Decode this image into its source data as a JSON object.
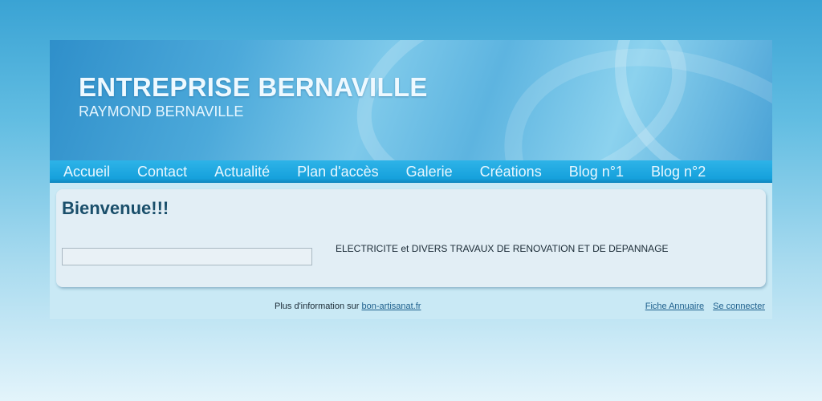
{
  "header": {
    "title": "ENTREPRISE BERNAVILLE",
    "subtitle": "RAYMOND BERNAVILLE"
  },
  "nav": {
    "items": [
      {
        "label": "Accueil"
      },
      {
        "label": "Contact"
      },
      {
        "label": "Actualité"
      },
      {
        "label": "Plan d'accès"
      },
      {
        "label": "Galerie"
      },
      {
        "label": "Créations"
      },
      {
        "label": "Blog n°1"
      },
      {
        "label": "Blog n°2"
      }
    ]
  },
  "main": {
    "welcome": "Bienvenue!!!",
    "description": "ELECTRICITE et DIVERS TRAVAUX DE RENOVATION ET DE DEPANNAGE"
  },
  "footer": {
    "info_prefix": "Plus d'information sur ",
    "info_link": "bon-artisanat.fr",
    "fiche_link": "Fiche Annuaire",
    "login_link": "Se connecter"
  },
  "colors": {
    "nav_bar": "#16a1dc",
    "heading": "#1a4f6b",
    "link": "#1d5f8c",
    "content_bg": "#e2eef5"
  }
}
